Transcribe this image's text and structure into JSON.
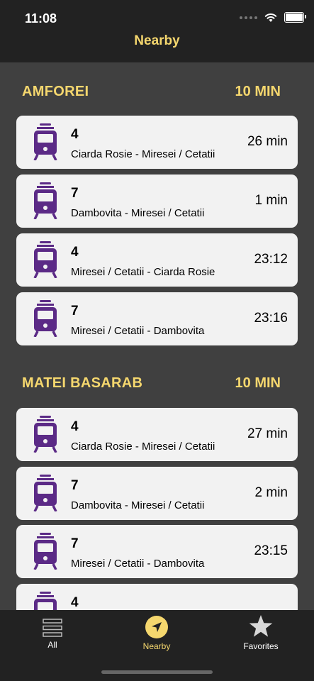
{
  "status": {
    "time": "11:08"
  },
  "header": {
    "title": "Nearby"
  },
  "sections": [
    {
      "name": "AMFOREI",
      "distance": "10 MIN",
      "items": [
        {
          "line": "4",
          "route": "Ciarda Rosie - Miresei / Cetatii",
          "eta": "26 min"
        },
        {
          "line": "7",
          "route": "Dambovita - Miresei / Cetatii",
          "eta": "1 min"
        },
        {
          "line": "4",
          "route": "Miresei / Cetatii - Ciarda Rosie",
          "eta": "23:12"
        },
        {
          "line": "7",
          "route": "Miresei / Cetatii - Dambovita",
          "eta": "23:16"
        }
      ]
    },
    {
      "name": "MATEI BASARAB",
      "distance": "10 MIN",
      "items": [
        {
          "line": "4",
          "route": "Ciarda Rosie - Miresei / Cetatii",
          "eta": "27 min"
        },
        {
          "line": "7",
          "route": "Dambovita - Miresei / Cetatii",
          "eta": "2 min"
        },
        {
          "line": "7",
          "route": "Miresei / Cetatii - Dambovita",
          "eta": "23:15"
        },
        {
          "line": "4",
          "route": "",
          "eta": ""
        }
      ]
    }
  ],
  "tabs": [
    {
      "label": "All",
      "icon": "list-icon",
      "active": false
    },
    {
      "label": "Nearby",
      "icon": "location-arrow-icon",
      "active": true
    },
    {
      "label": "Favorites",
      "icon": "star-icon",
      "active": false
    }
  ],
  "colors": {
    "accent": "#f5d76e",
    "tram_icon": "#5b2a86",
    "card_bg": "#f2f2f2",
    "background": "#404040",
    "bar_bg": "#222222"
  }
}
